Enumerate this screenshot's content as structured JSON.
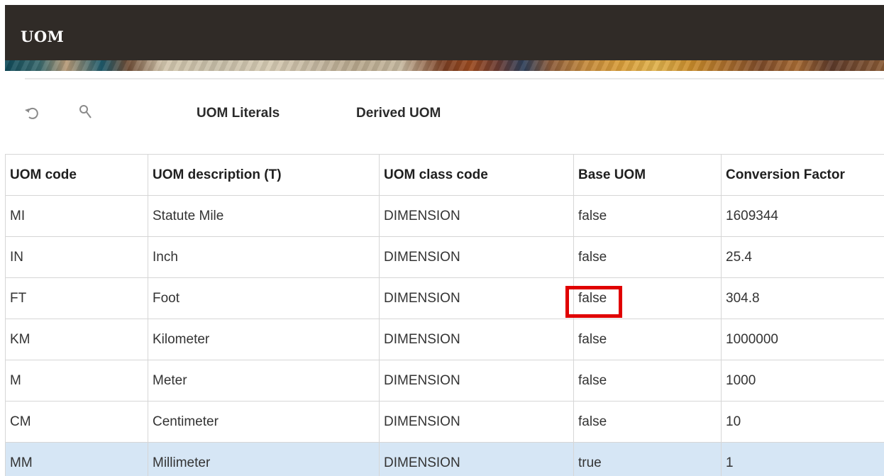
{
  "header": {
    "title": "UOM"
  },
  "toolbar": {
    "icons": [
      "refresh-icon",
      "search-icon"
    ],
    "tabs": [
      {
        "label": "UOM Literals"
      },
      {
        "label": "Derived UOM"
      }
    ]
  },
  "table": {
    "columns": [
      "UOM code",
      "UOM description (T)",
      "UOM class code",
      "Base UOM",
      "Conversion Factor"
    ],
    "rows": [
      [
        "MI",
        "Statute Mile",
        "DIMENSION",
        "false",
        "1609344"
      ],
      [
        "IN",
        "Inch",
        "DIMENSION",
        "false",
        "25.4"
      ],
      [
        "FT",
        "Foot",
        "DIMENSION",
        "false",
        "304.8"
      ],
      [
        "KM",
        "Kilometer",
        "DIMENSION",
        "false",
        "1000000"
      ],
      [
        "M",
        "Meter",
        "DIMENSION",
        "false",
        "1000"
      ],
      [
        "CM",
        "Centimeter",
        "DIMENSION",
        "false",
        "10"
      ],
      [
        "MM",
        "Millimeter",
        "DIMENSION",
        "true",
        "1"
      ]
    ],
    "selected_row": 6
  },
  "colors": {
    "header_bg": "#302b27",
    "selected_row": "#d6e6f5",
    "highlight": "#e00000"
  }
}
